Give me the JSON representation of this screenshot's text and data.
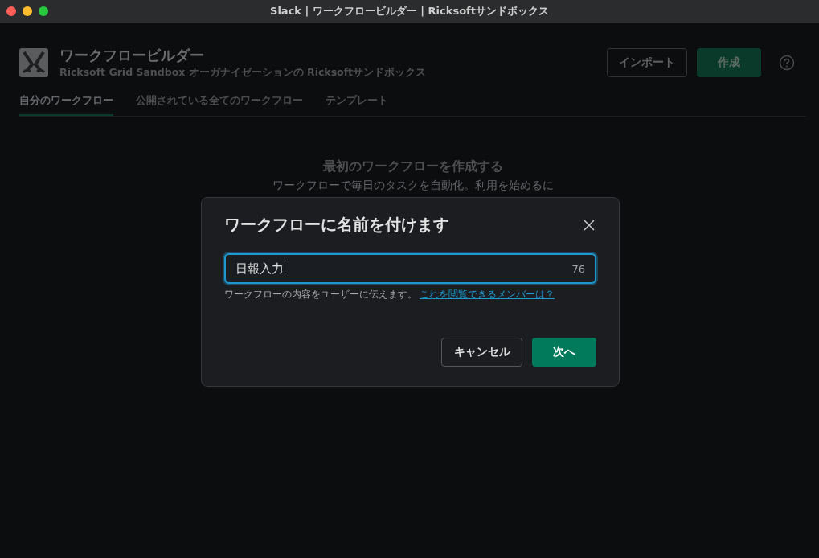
{
  "window": {
    "title": "Slack | ワークフロービルダー | Ricksoftサンドボックス"
  },
  "header": {
    "title": "ワークフロービルダー",
    "subtitle": "Ricksoft Grid Sandbox オーガナイゼーションの Ricksoftサンドボックス",
    "import_button": "インポート",
    "create_button": "作成"
  },
  "tabs": [
    {
      "label": "自分のワークフロー",
      "selected": true
    },
    {
      "label": "公開されている全てのワークフロー",
      "selected": false
    },
    {
      "label": "テンプレート",
      "selected": false
    }
  ],
  "empty_state": {
    "title": "最初のワークフローを作成する",
    "text": "ワークフローで毎日のタスクを自動化。利用を始めるに"
  },
  "dialog": {
    "title": "ワークフローに名前を付けます",
    "name_field": {
      "value": "日報入力",
      "remaining": "76"
    },
    "help": "ワークフローの内容をユーザーに伝えます。",
    "help_link": "これを閲覧できるメンバーは？",
    "cancel_button": "キャンセル",
    "next_button": "次へ"
  }
}
